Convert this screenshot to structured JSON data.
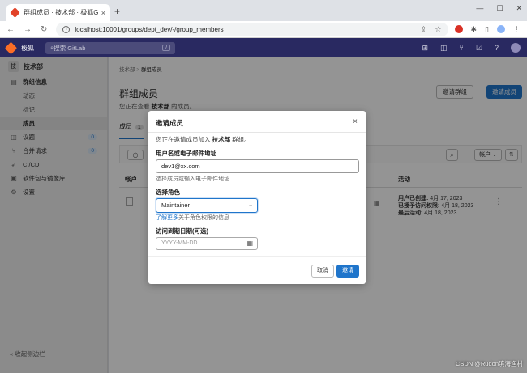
{
  "browser": {
    "tab_title": "群组成员 · 技术部 · 极狐Gi",
    "tab_close": "×",
    "new_tab": "+",
    "win_min": "—",
    "win_max": "☐",
    "win_close": "✕",
    "url": "localhost:10001/groups/dept_dev/-/group_members"
  },
  "header": {
    "brand": "极狐",
    "search_placeholder": "搜索 GitLab",
    "search_shortcut": "/"
  },
  "sidebar": {
    "group_letter": "技",
    "group_name": "技术部",
    "items": [
      {
        "label": "群组信息",
        "bold": true
      },
      {
        "label": "动态"
      },
      {
        "label": "标记"
      },
      {
        "label": "成员"
      },
      {
        "label": "议题",
        "badge": "0"
      },
      {
        "label": "合并请求",
        "badge": "0"
      },
      {
        "label": "CI/CD"
      },
      {
        "label": "软件包与镜像库"
      },
      {
        "label": "设置"
      }
    ],
    "collapse_label": "« 收起侧边栏"
  },
  "main": {
    "breadcrumb_parent": "技术部",
    "breadcrumb_sep": ">",
    "breadcrumb_current": "群组成员",
    "title": "群组成员",
    "desc_prefix": "您正在查看 ",
    "desc_group": "技术部",
    "desc_suffix": " 的成员。",
    "invite_group_label": "邀请群组",
    "invite_member_label": "邀请成员",
    "tab_members": "成员",
    "tab_count": "1",
    "sort_label": "帐户 ⌄",
    "th_account": "帐户",
    "th_activity": "活动",
    "row": {
      "created_label": "用户已创建:",
      "created_value": " 4月 17, 2023",
      "access_label": "已授予访问权限:",
      "access_value": " 4月 18, 2023",
      "last_label": "最后活动:",
      "last_value": " 4月 18, 2023"
    }
  },
  "modal": {
    "title": "邀请成员",
    "close": "×",
    "intro_prefix": "您正在邀请成员加入 ",
    "intro_group": "技术部",
    "intro_suffix": " 群组。",
    "user_label": "用户名或电子邮件地址",
    "user_value": "dev1@xx.com",
    "user_help": "选择成员或输入电子邮件地址",
    "role_label": "选择角色",
    "role_value": "Maintainer",
    "learn_more": "了解更多",
    "learn_more_suffix": "关于角色权限的信息",
    "date_label": "访问到期日期(可选)",
    "date_placeholder": "YYYY-MM-DD",
    "cancel_label": "取消",
    "invite_label": "邀请"
  },
  "watermark": "CSDN @Rudon滨海渔村",
  "colors": {
    "brand_header": "#292961",
    "primary": "#1f75cb",
    "logo": "#fc6d26"
  }
}
